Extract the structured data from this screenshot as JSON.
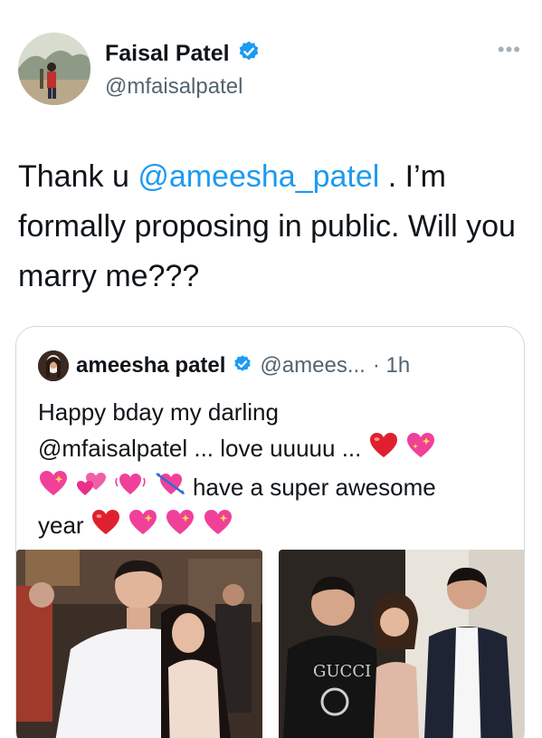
{
  "author": {
    "name": "Faisal Patel",
    "handle": "@mfaisalpatel",
    "verified_icon": "verified-badge-icon",
    "more_icon": "more-options-icon"
  },
  "tweet": {
    "text_before": "Thank u ",
    "mention": "@ameesha_patel",
    "text_after": " . I’m formally proposing in public. Will you marry me???"
  },
  "quoted": {
    "name": "ameesha patel",
    "handle": "@amees...",
    "time": "· 1h",
    "line1": "Happy bday my darling",
    "line2": "@mfaisalpatel ... love uuuuu ...",
    "line3_text": "have a super awesome",
    "line4_text": "year",
    "photos": [
      "photo-party-couple",
      "photo-group-three"
    ]
  },
  "colors": {
    "link": "#1d9bf0",
    "verified": "#1d9bf0",
    "text": "#0f1419",
    "muted": "#536471",
    "border": "#cfd9de",
    "heart_red": "#e0202e",
    "heart_pink": "#f0409a"
  }
}
